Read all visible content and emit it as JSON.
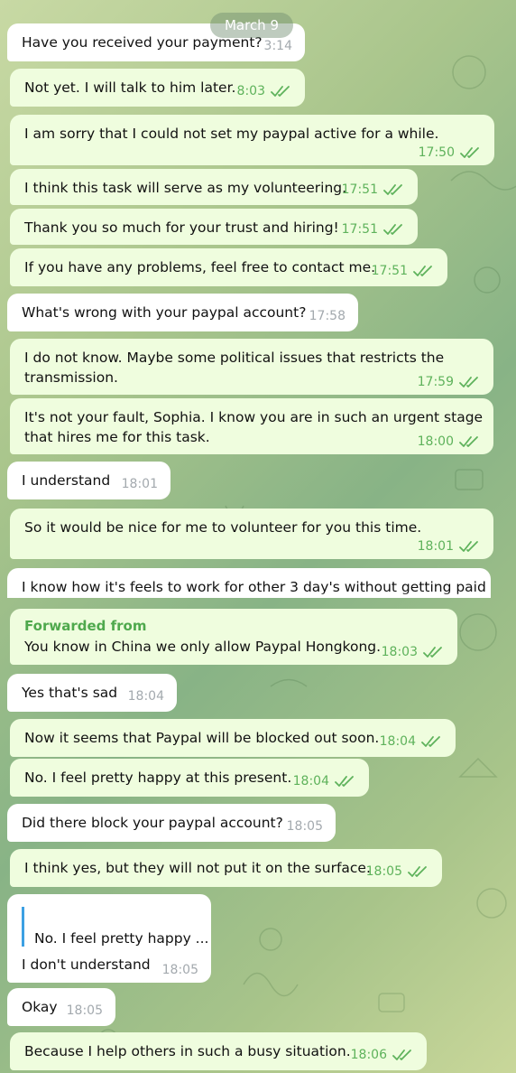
{
  "date_pill": "March 9",
  "messages": [
    {
      "dir": "in",
      "text": "Have you received your payment?",
      "time": "3:14",
      "read": false
    },
    {
      "dir": "out",
      "text": "Not yet. I will talk to him later.",
      "time": "8:03",
      "read": true
    },
    {
      "dir": "out",
      "text": "I am sorry that I could not set my paypal active for a while.",
      "time": "17:50",
      "read": true
    },
    {
      "dir": "out",
      "text": "I think this task will serve as my volunteering.",
      "time": "17:51",
      "read": true
    },
    {
      "dir": "out",
      "text": "Thank you so much for your trust and hiring!",
      "time": "17:51",
      "read": true
    },
    {
      "dir": "out",
      "text": "If you have any problems, feel free to contact me.",
      "time": "17:51",
      "read": true
    },
    {
      "dir": "in",
      "text": "What's wrong with your paypal account?",
      "time": "17:58",
      "read": false
    },
    {
      "dir": "out",
      "text": "I do not know. Maybe some political issues that restricts the\ntransmission.",
      "time": "17:59",
      "read": true
    },
    {
      "dir": "out",
      "text": "It's not your fault, Sophia. I know you are in such an urgent stage\nthat hires me for this task.",
      "time": "18:00",
      "read": true
    },
    {
      "dir": "in",
      "text": "I understand",
      "time": "18:01",
      "read": false
    },
    {
      "dir": "out",
      "text": "So it would be nice for me to volunteer for you this time.",
      "time": "18:01",
      "read": true
    },
    {
      "dir": "in",
      "text": "I know how it's feels to work for other 3 day's without getting paid",
      "time": "",
      "read": false
    },
    {
      "dir": "out",
      "forwarded_label": "Forwarded from",
      "text": "You know in China we only allow Paypal Hongkong.",
      "time": "18:03",
      "read": true
    },
    {
      "dir": "in",
      "text": "Yes that's sad",
      "time": "18:04",
      "read": false
    },
    {
      "dir": "out",
      "text": "Now it seems that Paypal will be blocked out soon.",
      "time": "18:04",
      "read": true
    },
    {
      "dir": "out",
      "text": "No. I feel pretty happy at this present.",
      "time": "18:04",
      "read": true
    },
    {
      "dir": "in",
      "text": "Did there block your paypal account?",
      "time": "18:05",
      "read": false
    },
    {
      "dir": "out",
      "text": "I think yes, but they will not put it on the surface.",
      "time": "18:05",
      "read": true
    },
    {
      "dir": "in",
      "reply_quote": "No. I feel pretty happy ...",
      "text": "I don't understand",
      "time": "18:05",
      "read": false
    },
    {
      "dir": "in",
      "text": "Okay",
      "time": "18:05",
      "read": false
    },
    {
      "dir": "out",
      "text": "Because I help others in such a busy situation.",
      "time": "18:06",
      "read": true
    }
  ],
  "colors": {
    "incoming_bubble": "#ffffff",
    "outgoing_bubble": "#effdde",
    "outgoing_meta": "#5eb25b",
    "incoming_meta": "#a3a9ae",
    "forward_label": "#4fa94d",
    "reply_bar": "#3ca0e3"
  },
  "icons": {
    "read_receipt": "double-check-icon"
  }
}
